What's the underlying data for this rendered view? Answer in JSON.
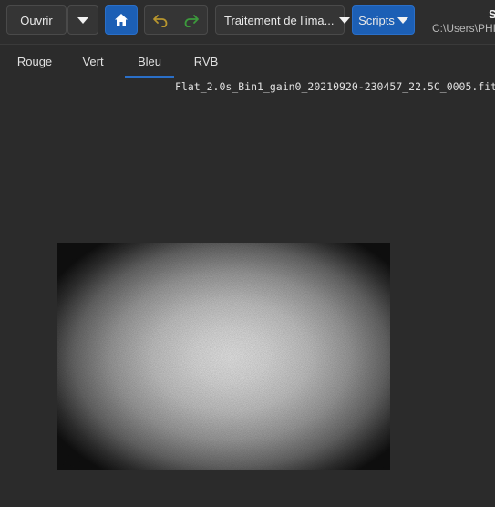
{
  "toolbar": {
    "open_label": "Ouvrir",
    "processing_label": "Traitement de l'ima...",
    "scripts_label": "Scripts",
    "window_title": "S",
    "path": "C:\\Users\\PHII",
    "icons": {
      "dropdown": "chevron-down-icon",
      "home": "home-icon",
      "undo": "undo-icon",
      "redo": "redo-icon"
    }
  },
  "tabs": [
    {
      "label": "Rouge",
      "active": false
    },
    {
      "label": "Vert",
      "active": false
    },
    {
      "label": "Bleu",
      "active": true
    },
    {
      "label": "RVB",
      "active": false
    }
  ],
  "viewer": {
    "filename": "Flat_2.0s_Bin1_gain0_20210920-230457_22.5C_0005.fit"
  },
  "colors": {
    "accent": "#1c5fb5",
    "background": "#2b2b2b",
    "undo_color": "#b8962e",
    "redo_color": "#3c9a3c"
  }
}
